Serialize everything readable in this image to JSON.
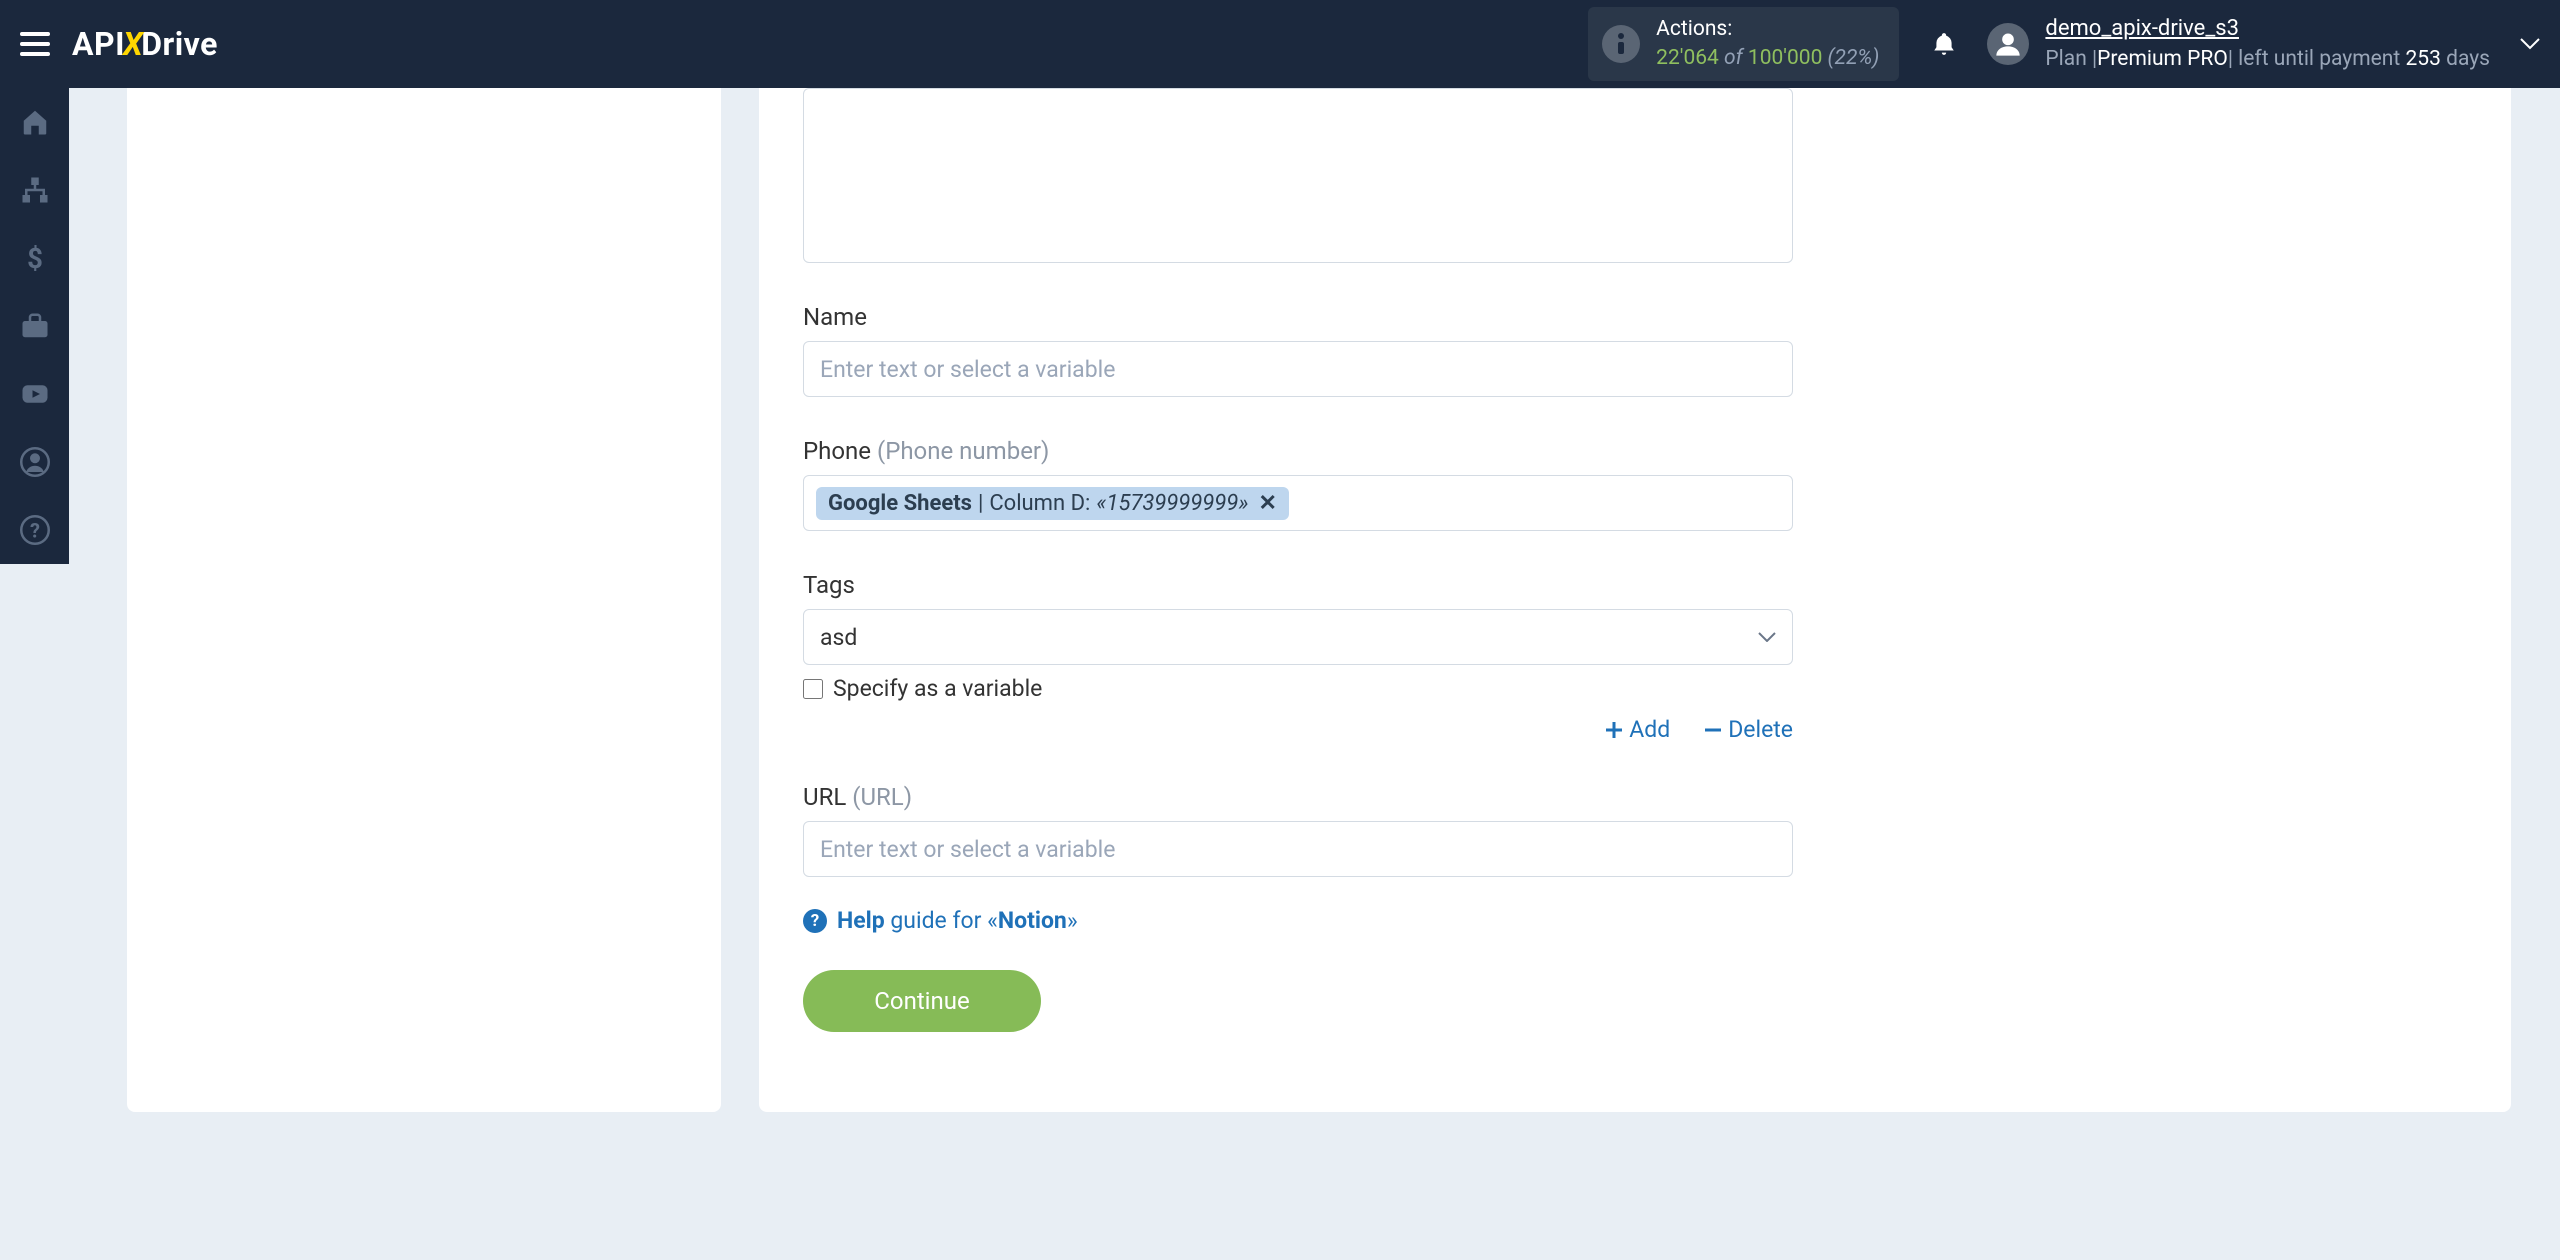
{
  "header": {
    "logo": {
      "api": "API",
      "x": "X",
      "drive": "Drive"
    },
    "actions": {
      "label": "Actions:",
      "current": "22'064",
      "of": " of ",
      "total": "100'000",
      "pct": " (22%)"
    },
    "user": {
      "name": "demo_apix-drive_s3",
      "plan_prefix": "Plan |",
      "plan_name": "Premium PRO",
      "plan_sep": "| left until payment ",
      "days": "253",
      "days_suffix": " days"
    }
  },
  "form": {
    "name": {
      "label": "Name",
      "placeholder": "Enter text or select a variable"
    },
    "phone": {
      "label": "Phone",
      "hint": "(Phone number)",
      "token_src": "Google Sheets",
      "token_sep": " | ",
      "token_col": "Column D: ",
      "token_val": "«15739999999»",
      "token_x": "✕"
    },
    "tags": {
      "label": "Tags",
      "value": "asd",
      "checkbox": "Specify as a variable",
      "add": "Add",
      "delete": "Delete"
    },
    "url": {
      "label": "URL",
      "hint": "(URL)",
      "placeholder": "Enter text or select a variable"
    },
    "help": {
      "prefix": "Help",
      "mid": " guide for «",
      "target": "Notion",
      "suffix": "»"
    },
    "continue": "Continue"
  }
}
